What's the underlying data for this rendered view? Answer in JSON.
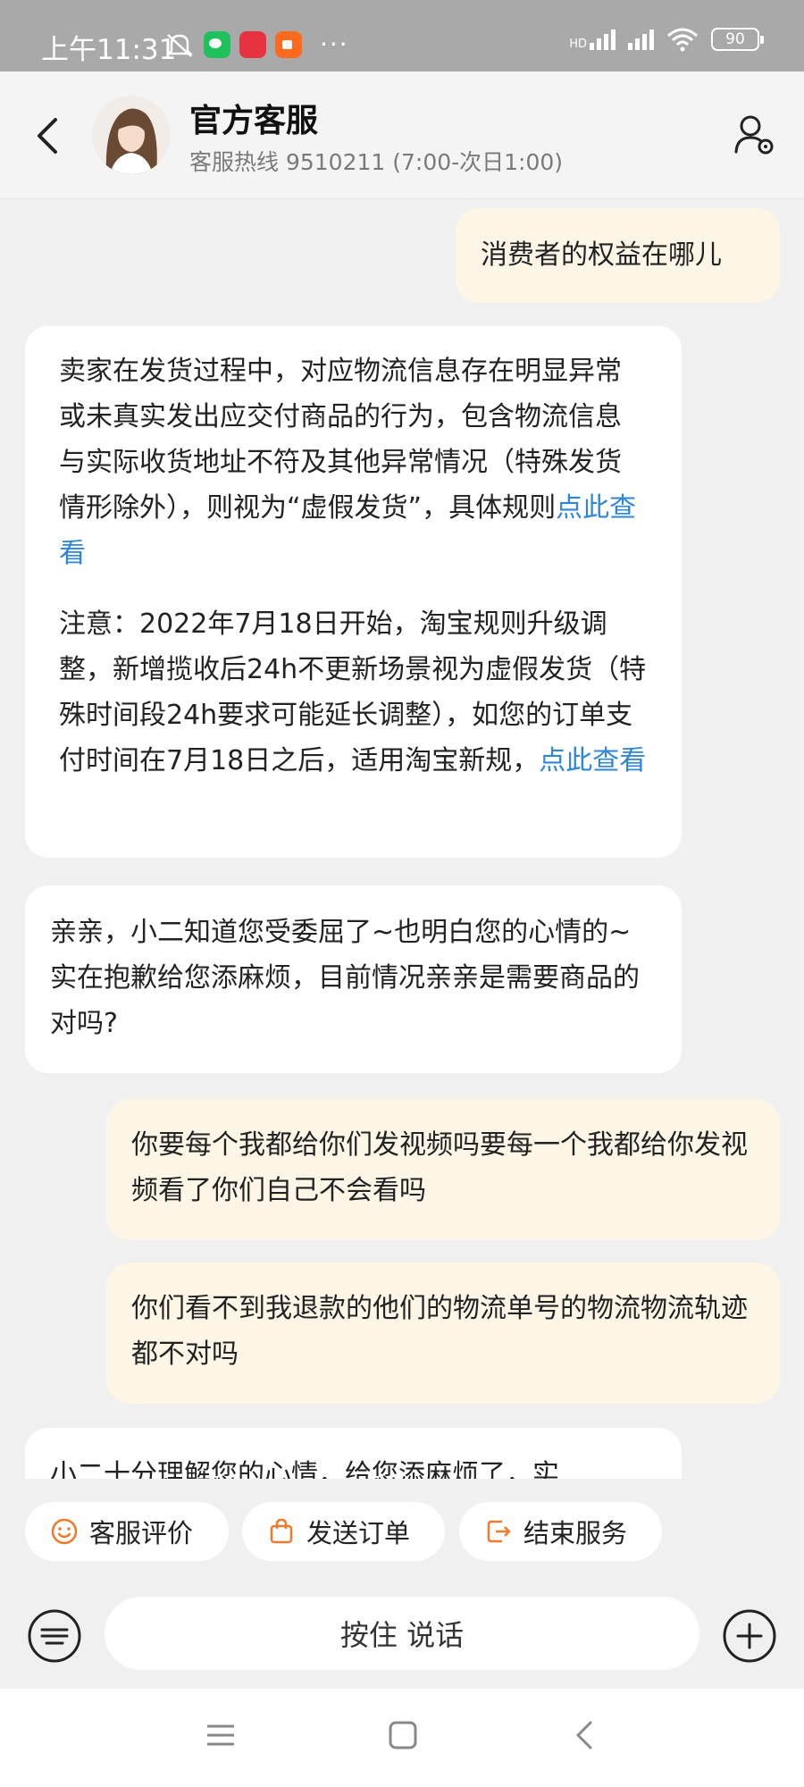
{
  "status_bar": {
    "time": "上午11:31",
    "more": "···",
    "battery": "90",
    "hd": "HD"
  },
  "header": {
    "title": "官方客服",
    "subtitle": "客服热线 9510211 (7:00-次日1:00)"
  },
  "messages": [
    {
      "from": "user",
      "text": "消费者的权益在哪儿"
    },
    {
      "from": "agent",
      "p1": " 卖家在发货过程中，对应物流信息存在明显异常或未真实发出应交付商品的行为，包含物流信息与实际收货地址不符及其他异常情况（特殊发货情形除外），则视为“虚假发货”，具体规则",
      "p1_link": "点此查看",
      "p2": "注意：2022年7月18日开始，淘宝规则升级调整，新增揽收后24h不更新场景视为虚假发货（特殊时间段24h要求可能延长调整），如您的订单支付时间在7月18日之后，适用淘宝新规，",
      "p2_link": "点此查看"
    },
    {
      "from": "agent",
      "text": "亲亲，小二知道您受委屈了~也明白您的心情的~实在抱歉给您添麻烦，目前情况亲亲是需要商品的对吗?"
    },
    {
      "from": "user",
      "text": "你要每个我都给你们发视频吗要每一个我都给你发视频看了你们自己不会看吗"
    },
    {
      "from": "user",
      "text": "你们看不到我退款的他们的物流单号的物流物流轨迹都不对吗"
    },
    {
      "from": "agent",
      "text": "小二十分理解您的心情，给您添麻烦了，实"
    }
  ],
  "quick_actions": [
    {
      "label": "客服评价",
      "icon": "smiley-icon"
    },
    {
      "label": "发送订单",
      "icon": "shopping-bag-icon"
    },
    {
      "label": "结束服务",
      "icon": "exit-icon"
    }
  ],
  "input_bar": {
    "voice_label": "按住 说话"
  },
  "colors": {
    "accent_orange": "#f07a2c",
    "link_blue": "#2f86d6",
    "user_bubble": "#fdf5e6",
    "agent_bubble": "#ffffff"
  }
}
